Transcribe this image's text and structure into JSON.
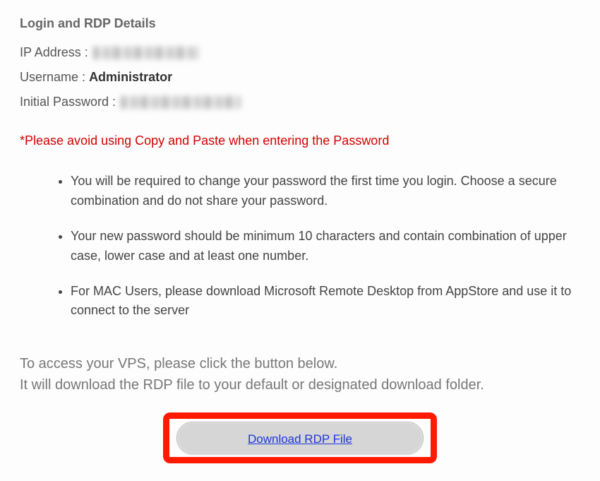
{
  "heading": "Login and RDP Details",
  "fields": {
    "ip_label": "IP Address :",
    "ip_value": "",
    "username_label": "Username :",
    "username_value": "Administrator",
    "password_label": "Initial Password :",
    "password_value": ""
  },
  "warning": "*Please avoid using Copy and Paste when entering the Password",
  "notes": [
    "You will be required to change your password the first time you login. Choose a secure combination and do not share your password.",
    "Your new password should be minimum 10 characters and contain combination of upper case, lower case and at least one number.",
    "For MAC Users, please download Microsoft Remote Desktop from AppStore and use it to connect to the server"
  ],
  "access_line1": "To access your VPS, please click the button below.",
  "access_line2": "It will download the RDP file to your default or designated download folder.",
  "download_label": "Download RDP File"
}
